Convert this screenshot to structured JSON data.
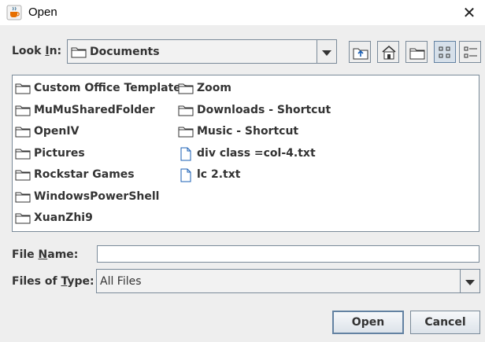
{
  "window": {
    "title": "Open",
    "app_icon": "java-cup-icon",
    "close_glyph": "✕"
  },
  "look_in": {
    "label_prefix": "Look ",
    "label_mnemonic": "I",
    "label_suffix": "n:",
    "value": "Documents"
  },
  "toolbar": {
    "buttons": [
      "up-one-level-icon",
      "home-icon",
      "new-folder-icon",
      "list-view-icon",
      "details-view-icon"
    ],
    "active": "list-view-icon"
  },
  "files": [
    {
      "name": "Custom Office Templates",
      "type": "folder"
    },
    {
      "name": "MuMuSharedFolder",
      "type": "folder"
    },
    {
      "name": "OpenIV",
      "type": "folder"
    },
    {
      "name": "Pictures",
      "type": "folder"
    },
    {
      "name": "Rockstar Games",
      "type": "folder"
    },
    {
      "name": "WindowsPowerShell",
      "type": "folder"
    },
    {
      "name": "XuanZhi9",
      "type": "folder"
    },
    {
      "name": "Zoom",
      "type": "folder"
    },
    {
      "name": "Downloads - Shortcut",
      "type": "folder"
    },
    {
      "name": "Music - Shortcut",
      "type": "folder"
    },
    {
      "name": "div class =col-4.txt",
      "type": "file"
    },
    {
      "name": "lc 2.txt",
      "type": "file"
    }
  ],
  "file_name": {
    "label_prefix": "File ",
    "label_mnemonic": "N",
    "label_suffix": "ame:",
    "value": ""
  },
  "files_of_type": {
    "label_prefix": "Files of ",
    "label_mnemonic": "T",
    "label_suffix": "ype:",
    "value": "All Files"
  },
  "buttons": {
    "open": "Open",
    "cancel": "Cancel"
  },
  "colors": {
    "background": "#eeeeee",
    "border": "#7a8a99",
    "active_button": "#d6e0ea"
  }
}
